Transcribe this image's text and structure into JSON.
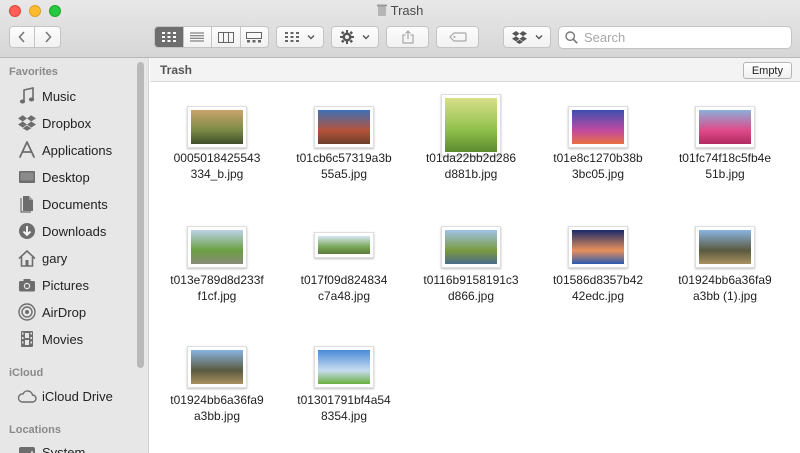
{
  "window": {
    "title": "Trash"
  },
  "toolbar": {
    "search_placeholder": "Search"
  },
  "sidebar": {
    "favorites_header": "Favorites",
    "favorites": [
      {
        "label": "Music",
        "icon": "music-note-icon"
      },
      {
        "label": "Dropbox",
        "icon": "dropbox-icon"
      },
      {
        "label": "Applications",
        "icon": "applications-icon"
      },
      {
        "label": "Desktop",
        "icon": "desktop-icon"
      },
      {
        "label": "Documents",
        "icon": "documents-icon"
      },
      {
        "label": "Downloads",
        "icon": "downloads-icon"
      },
      {
        "label": "gary",
        "icon": "home-icon"
      },
      {
        "label": "Pictures",
        "icon": "camera-icon"
      },
      {
        "label": "AirDrop",
        "icon": "airdrop-icon"
      },
      {
        "label": "Movies",
        "icon": "film-icon"
      }
    ],
    "icloud_header": "iCloud",
    "icloud": [
      {
        "label": "iCloud Drive",
        "icon": "cloud-icon"
      }
    ],
    "locations_header": "Locations",
    "locations": [
      {
        "label": "System",
        "icon": "disk-icon"
      }
    ]
  },
  "content": {
    "path_title": "Trash",
    "empty_label": "Empty",
    "files": [
      {
        "line1": "0005018425543",
        "line2": "334_b.jpg",
        "colors": [
          "#c9a46a",
          "#7a8a45",
          "#3f4d2a"
        ]
      },
      {
        "line1": "t01cb6c57319a3b",
        "line2": "55a5.jpg",
        "colors": [
          "#3d6fb6",
          "#b5533a",
          "#6b3f2a"
        ]
      },
      {
        "line1": "t01da22bb2d286",
        "line2": "d881b.jpg",
        "colors": [
          "#d8e08a",
          "#8fbf4a",
          "#5a8a2e"
        ]
      },
      {
        "line1": "t01e8c1270b38b",
        "line2": "3bc05.jpg",
        "colors": [
          "#3b4fb0",
          "#c24aa0",
          "#e87040"
        ]
      },
      {
        "line1": "t01fc74f18c5fb4e",
        "line2": "51b.jpg",
        "colors": [
          "#8ab0d8",
          "#e04a8a",
          "#b02a60"
        ]
      },
      {
        "line1": "t013e789d8d233f",
        "line2": "f1cf.jpg",
        "colors": [
          "#bcd3e8",
          "#6aa040",
          "#8a8a7a"
        ]
      },
      {
        "line1": "t017f09d824834",
        "line2": "c7a48.jpg",
        "colors": [
          "#d8e6f2",
          "#7aa858",
          "#5a7a3a"
        ]
      },
      {
        "line1": "t0116b9158191c3",
        "line2": "d866.jpg",
        "colors": [
          "#a0c4e6",
          "#7a9a40",
          "#4a6a8a"
        ]
      },
      {
        "line1": "t01586d8357b42",
        "line2": "42edc.jpg",
        "colors": [
          "#1a2a6a",
          "#e8905a",
          "#2a5ab0"
        ]
      },
      {
        "line1": "t01924bb6a36fa9",
        "line2": "a3bb (1).jpg",
        "colors": [
          "#8ab4e0",
          "#5a5a40",
          "#a89060"
        ]
      },
      {
        "line1": "t01924bb6a36fa9",
        "line2": "a3bb.jpg",
        "colors": [
          "#8ab4e0",
          "#5a5a40",
          "#a89060"
        ]
      },
      {
        "line1": "t01301791bf4a54",
        "line2": "8354.jpg",
        "colors": [
          "#4a8ad8",
          "#c8dcf0",
          "#6ab040"
        ]
      }
    ]
  }
}
